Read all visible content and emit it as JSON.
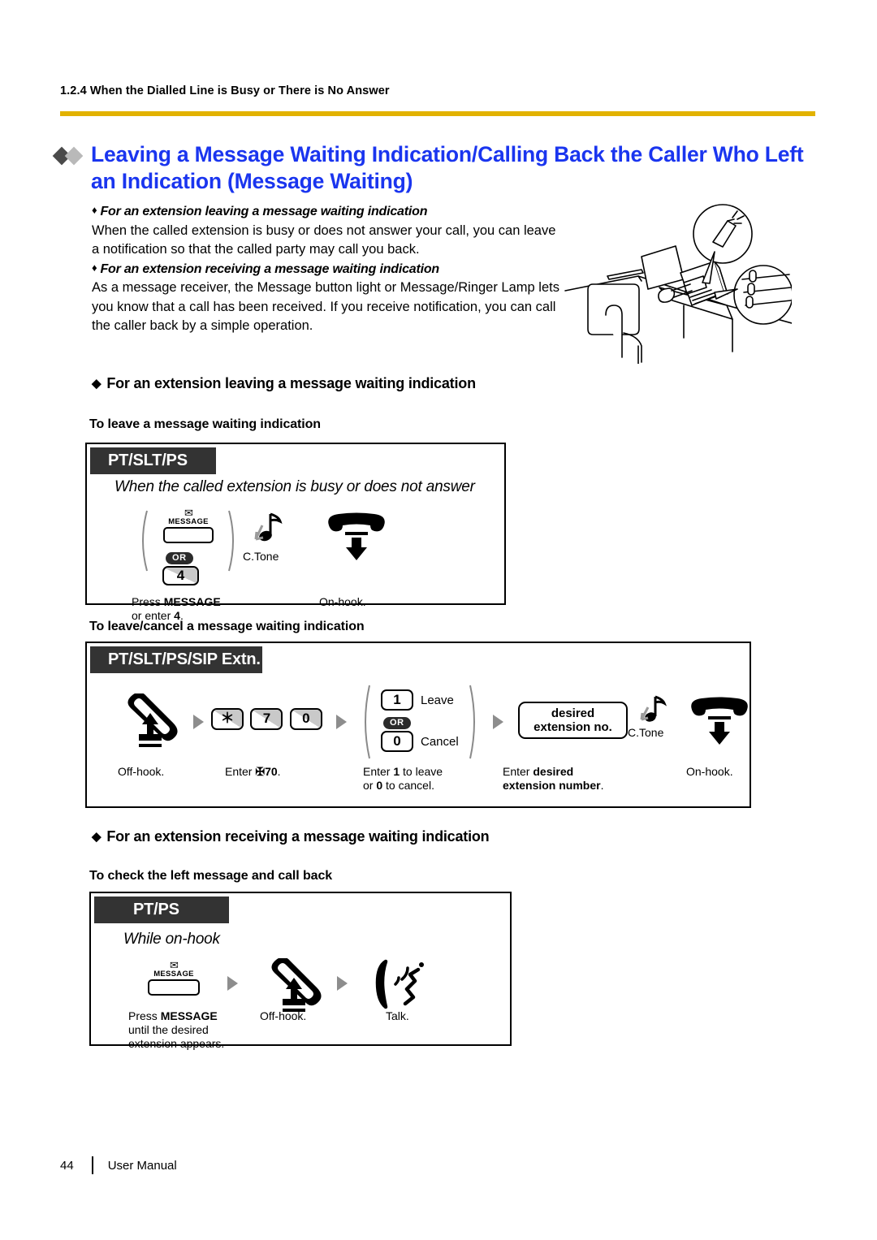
{
  "header": {
    "breadcrumb": "1.2.4 When the Dialled Line is Busy or There is No Answer",
    "rule_color": "#e2b200"
  },
  "main_title": {
    "text": "Leaving a Message Waiting Indication/Calling Back the Caller Who Left an Indication (Message Waiting)",
    "color": "#1a35ef",
    "bullet_dark": "#4a4a4a",
    "bullet_light": "#b9b9b9"
  },
  "intro": {
    "sub1": "For an extension leaving a message waiting indication",
    "para1": "When the called extension is busy or does not answer your call, you can leave a notification so that the called party may call you back.",
    "sub2": "For an extension receiving a message waiting indication",
    "para2": "As a message receiver, the Message button light or Message/Ringer Lamp lets you know that a call has been received. If you receive notification, you can call the caller back by a simple operation.",
    "bullet": "♦"
  },
  "sections": [
    {
      "heading": "For an extension leaving a message waiting indication",
      "bullet": "◆",
      "subheadings": [
        "To leave a message waiting indication",
        "To leave/cancel a message waiting indication"
      ]
    },
    {
      "heading": "For an extension receiving a message waiting indication",
      "bullet": "◆",
      "subheadings": [
        "To check the left message and call back"
      ]
    }
  ],
  "diagram1": {
    "tab": "PT/SLT/PS",
    "note": "When the called extension is busy or does not answer",
    "message_button": {
      "envelope_icon": "envelope-icon",
      "label": "MESSAGE"
    },
    "or_pill": "OR",
    "key4": "4",
    "step1_line1_prefix": "Press ",
    "step1_line1_bold": "MESSAGE",
    "step1_line2_prefix": "or enter ",
    "step1_line2_bold": "4",
    "step1_line2_suffix": ".",
    "ctone_label": "C.Tone",
    "onhook_label": "On-hook."
  },
  "diagram2": {
    "tab": "PT/SLT/PS/SIP Extn.",
    "keys_feature": [
      "＊",
      "7",
      "0"
    ],
    "key_leave": "1",
    "key_leave_label": "Leave",
    "or_pill": "OR",
    "key_cancel": "0",
    "key_cancel_label": "Cancel",
    "ext_box_line1": "desired",
    "ext_box_line2": "extension no.",
    "ctone_label": "C.Tone",
    "steps": [
      {
        "line1": "Off-hook."
      },
      {
        "line1_prefix": "Enter ",
        "line1_bold": "✠70",
        "line1_suffix": "."
      },
      {
        "line1_prefix": "Enter ",
        "line1_bold": "1",
        "line1_suffix": " to leave",
        "line2_prefix": "or ",
        "line2_bold": "0",
        "line2_suffix": " to cancel."
      },
      {
        "line1_prefix": "Enter ",
        "line1_bold": "desired",
        "line2_bold": "extension number",
        "line2_suffix": "."
      },
      {
        "line1": "On-hook."
      }
    ]
  },
  "diagram3": {
    "tab": "PT/PS",
    "note": "While on-hook",
    "message_button": {
      "envelope_icon": "envelope-icon",
      "label": "MESSAGE"
    },
    "step1_line1_prefix": "Press ",
    "step1_line1_bold": "MESSAGE",
    "step1_line2": "until the desired",
    "step1_line3": "extension appears.",
    "step2": "Off-hook.",
    "step3": "Talk."
  },
  "footer": {
    "page_number": "44",
    "label": "User Manual"
  }
}
